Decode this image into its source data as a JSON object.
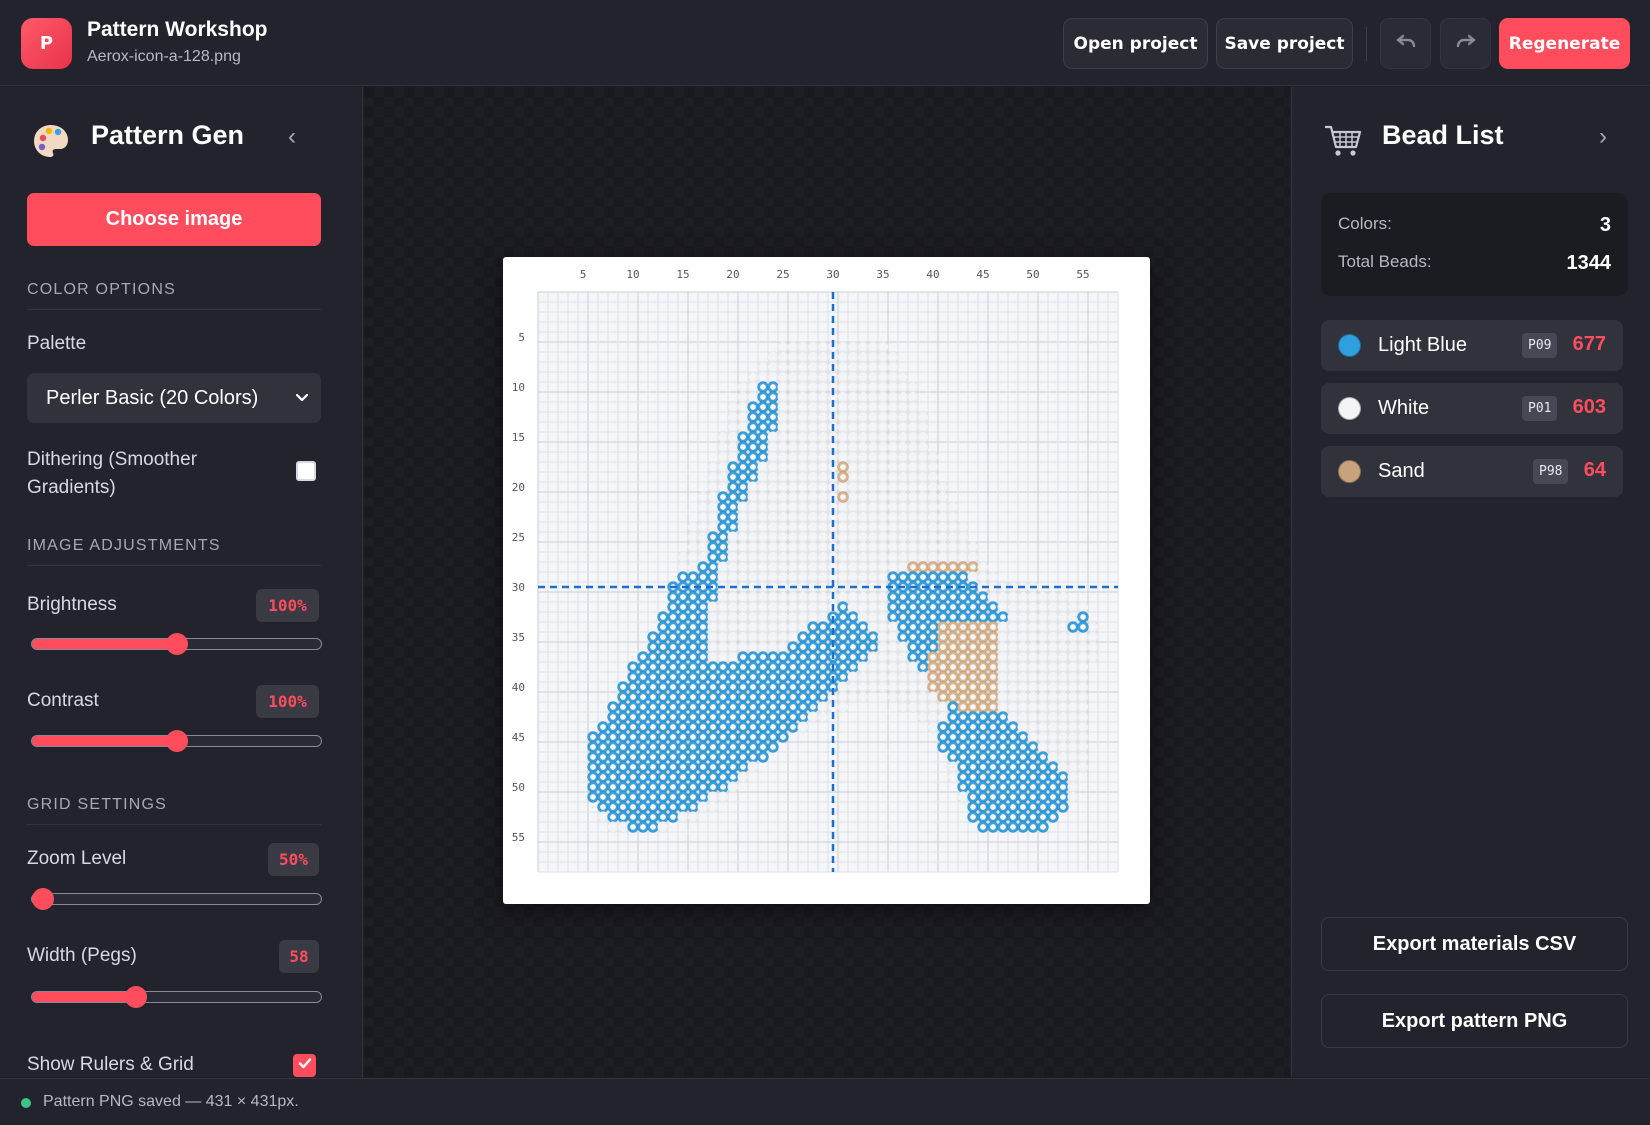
{
  "header": {
    "logo_letter": "P",
    "title": "Pattern Workshop",
    "filename": "Aerox-icon-a-128.png",
    "open_label": "Open project",
    "save_label": "Save project",
    "undo_icon": "undo-icon",
    "redo_icon": "redo-icon",
    "regenerate_label": "Regenerate",
    "accent_color": "#ff4d5e"
  },
  "left_panel": {
    "title": "Pattern Gen",
    "icon": "palette-icon",
    "collapse_icon": "chevron-left-icon",
    "choose_label": "Choose image",
    "color_section": "COLOR OPTIONS",
    "palette_label": "Palette",
    "palette_value": "Perler Basic (20 Colors)",
    "dithering_label": "Dithering (Smoother Gradients)",
    "dithering_checked": false,
    "adjust_section": "IMAGE ADJUSTMENTS",
    "brightness_label": "Brightness",
    "brightness_value": "100%",
    "brightness_fraction": 0.5,
    "contrast_label": "Contrast",
    "contrast_value": "100%",
    "contrast_fraction": 0.5,
    "grid_section": "GRID SETTINGS",
    "zoom_label": "Zoom Level",
    "zoom_value": "50%",
    "zoom_fraction": 0.0,
    "width_label": "Width (Pegs)",
    "width_value": "58",
    "width_fraction": 0.35,
    "rulers_label": "Show Rulers & Grid",
    "rulers_checked": true
  },
  "pattern": {
    "x_ticks": [
      "5",
      "10",
      "15",
      "20",
      "25",
      "30",
      "35",
      "40",
      "45",
      "50",
      "55"
    ],
    "y_ticks": [
      "5",
      "10",
      "15",
      "20",
      "25",
      "30",
      "35",
      "40",
      "45",
      "50",
      "55"
    ],
    "grid_size": 58,
    "center_x": 30,
    "center_y": 30,
    "guide_color": "#1a6fd1",
    "bead_colors": {
      "blue": "#3aa0dc",
      "white": "#f2f2f4",
      "sand": "#d9b48c"
    }
  },
  "right_panel": {
    "title": "Bead List",
    "icon": "cart-icon",
    "collapse_icon": "chevron-right-icon",
    "colors_label": "Colors:",
    "colors_value": "3",
    "total_label": "Total Beads:",
    "total_value": "1344",
    "beads": [
      {
        "name": "Light Blue",
        "code": "P09",
        "count": "677",
        "color": "#2f9fe0"
      },
      {
        "name": "White",
        "code": "P01",
        "count": "603",
        "color": "#f4f4f6"
      },
      {
        "name": "Sand",
        "code": "P98",
        "count": "64",
        "color": "#c8a27c"
      }
    ],
    "export_csv_label": "Export materials CSV",
    "export_png_label": "Export pattern PNG"
  },
  "status": {
    "text": "Pattern PNG saved — 431 × 431px.",
    "color": "#3ec48a"
  }
}
